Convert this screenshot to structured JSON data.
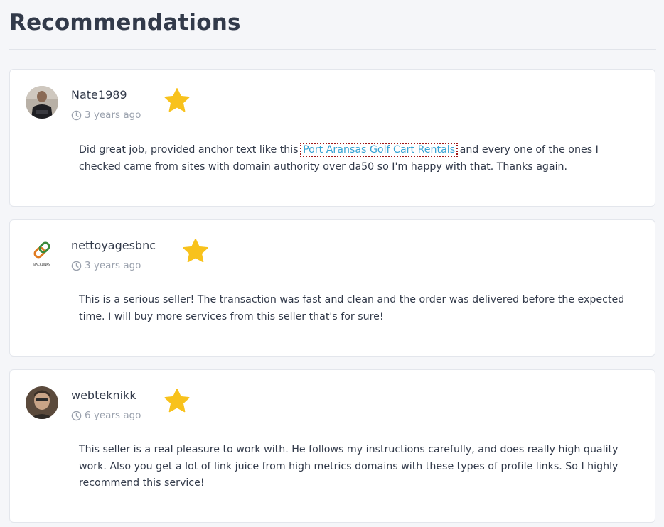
{
  "page": {
    "title": "Recommendations"
  },
  "colors": {
    "star": "#f8c21c",
    "link": "#36a3d4",
    "text": "#323a4a",
    "muted": "#9aa1ad"
  },
  "reviews": [
    {
      "username": "Nate1989",
      "time": "3 years ago",
      "rating_icon": "star-icon",
      "text_before": "Did great job, provided anchor text like this ",
      "link_text": "Port Aransas Golf Cart Rentals",
      "text_after": " and every one of the ones I checked came from sites with domain authority over da50 so I'm happy with that. Thanks again."
    },
    {
      "username": "nettoyagesbnc",
      "time": "3 years ago",
      "rating_icon": "star-icon",
      "avatar_text": "BACKLINKS",
      "text": "This is a serious seller! The transaction was fast and clean and the order was delivered before the expected time. I will buy more services from this seller that's for sure!"
    },
    {
      "username": "webteknikk",
      "time": "6 years ago",
      "rating_icon": "star-icon",
      "text": "This seller is a real pleasure to work with. He follows my instructions carefully, and does really high quality work. Also you get a lot of link juice from high metrics domains with these types of profile links. So I highly recommend this service!"
    }
  ]
}
